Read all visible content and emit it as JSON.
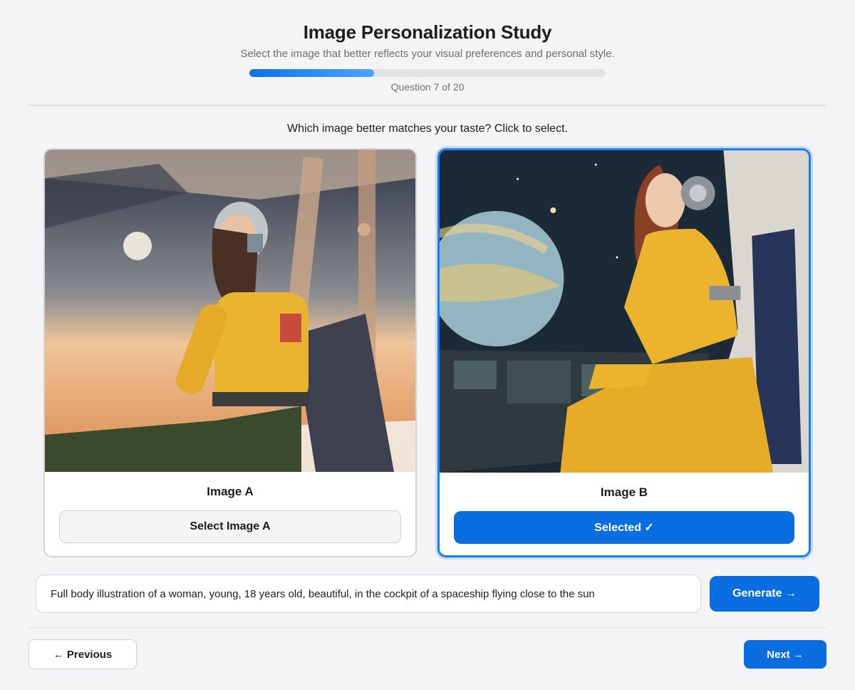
{
  "header": {
    "title": "Image Personalization Study",
    "subtitle": "Select the image that better reflects your visual preferences and personal style.",
    "progress_text": "Question 7 of 20",
    "progress_fraction": 0.35
  },
  "question": "Which image better matches your taste? Click to select.",
  "options": [
    {
      "label": "Image A",
      "button": "Select Image A",
      "selected": false
    },
    {
      "label": "Image B",
      "button": "Selected ✓",
      "selected": true
    }
  ],
  "prompt": {
    "value": "Full body illustration of a woman, young, 18 years old, beautiful, in the cockpit of a spaceship flying close to the sun"
  },
  "actions": {
    "generate": "Generate →",
    "previous": "← Previous",
    "next": "Next →"
  },
  "colors": {
    "accent": "#0a6ee0",
    "background": "#f4f4f6"
  }
}
